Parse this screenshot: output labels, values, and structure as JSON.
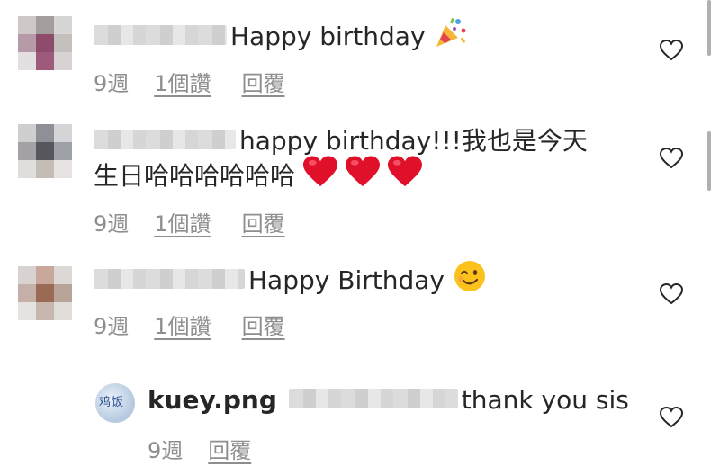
{
  "comments": [
    {
      "text": "Happy birthday",
      "emoji": "party-popper",
      "time": "9週",
      "likes": "1個讚",
      "reply": "回覆"
    },
    {
      "text_line1": "happy birthday!!!我也是今天",
      "text_line2": "生日哈哈哈哈哈哈",
      "emoji": "red-heart x3",
      "time": "9週",
      "likes": "1個讚",
      "reply": "回覆"
    },
    {
      "text": "Happy Birthday",
      "emoji": "winking-face",
      "time": "9週",
      "likes": "1個讚",
      "reply": "回覆"
    }
  ],
  "reply_comment": {
    "username": "kuey.png",
    "avatar_text": "鸡饭",
    "text": "thank you sis",
    "time": "9週",
    "reply": "回覆"
  },
  "colors": {
    "text": "#262626",
    "meta": "#8e8e8e",
    "heart_outline": "#262626",
    "emoji_heart": "#e0102a"
  }
}
